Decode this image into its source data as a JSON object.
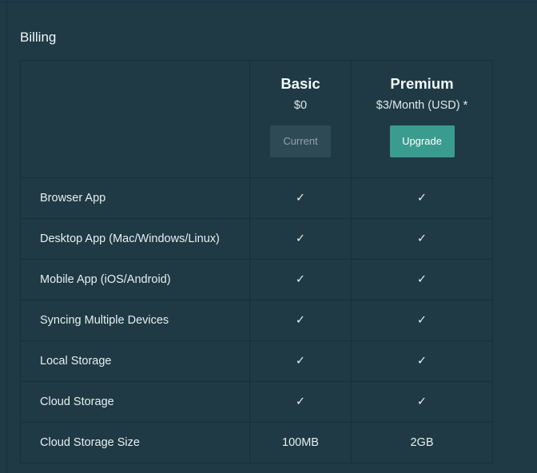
{
  "section": {
    "title": "Billing"
  },
  "plans": [
    {
      "name": "Basic",
      "price": "$0",
      "button_label": "Current"
    },
    {
      "name": "Premium",
      "price": "$3/Month (USD) *",
      "button_label": "Upgrade"
    }
  ],
  "features": [
    {
      "label": "Browser App",
      "basic": "✓",
      "premium": "✓"
    },
    {
      "label": "Desktop App (Mac/Windows/Linux)",
      "basic": "✓",
      "premium": "✓"
    },
    {
      "label": "Mobile App (iOS/Android)",
      "basic": "✓",
      "premium": "✓"
    },
    {
      "label": "Syncing Multiple Devices",
      "basic": "✓",
      "premium": "✓"
    },
    {
      "label": "Local Storage",
      "basic": "✓",
      "premium": "✓"
    },
    {
      "label": "Cloud Storage",
      "basic": "✓",
      "premium": "✓"
    },
    {
      "label": "Cloud Storage Size",
      "basic": "100MB",
      "premium": "2GB"
    }
  ],
  "colors": {
    "background": "#1f3a45",
    "border": "#17303a",
    "accent": "#3a9c8f",
    "current_button": "#2d4a55"
  }
}
